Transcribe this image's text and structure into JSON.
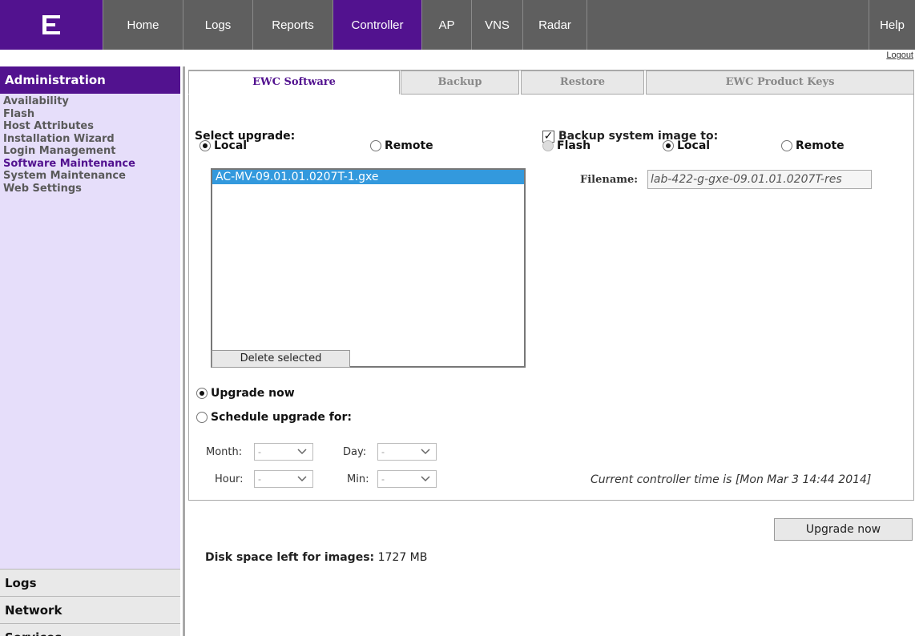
{
  "nav": {
    "items": [
      "Home",
      "Logs",
      "Reports",
      "Controller",
      "AP",
      "VNS",
      "Radar"
    ],
    "active": "Controller",
    "help": "Help",
    "logo_icon": "extreme-logo-icon"
  },
  "logout": "Logout",
  "sidebar": {
    "header": "Administration",
    "links": [
      "Availability",
      "Flash",
      "Host Attributes",
      "Installation Wizard",
      "Login Management",
      "Software Maintenance",
      "System Maintenance",
      "Web Settings"
    ],
    "current": "Software Maintenance",
    "sections": [
      "Logs",
      "Network",
      "Services"
    ]
  },
  "tabs": [
    "EWC Software",
    "Backup",
    "Restore",
    "EWC Product Keys"
  ],
  "upgrade": {
    "select_label": "Select upgrade:",
    "local": "Local",
    "remote": "Remote",
    "selected_source": "Local",
    "images": [
      "AC-MV-09.01.01.0207T-1.gxe"
    ],
    "delete_button": "Delete selected",
    "upgrade_now_label": "Upgrade now",
    "schedule_label": "Schedule upgrade for:",
    "month_label": "Month:",
    "day_label": "Day:",
    "hour_label": "Hour:",
    "min_label": "Min:",
    "month_value": "-",
    "day_value": "-",
    "hour_value": "-",
    "min_value": "-"
  },
  "backup": {
    "checkbox_label": "Backup system image to:",
    "checked": true,
    "flash": "Flash",
    "local": "Local",
    "remote": "Remote",
    "selected": "Local",
    "filename_label": "Filename:",
    "filename_value": "lab-422-g-gxe-09.01.01.0207T-res"
  },
  "controller_time": "Current controller time is [Mon Mar 3 14:44 2014]",
  "upgrade_button": "Upgrade now",
  "disk": {
    "label": "Disk space left for images:",
    "value": "1727 MB"
  },
  "colors": {
    "accent": "#52128f",
    "nav_bg": "#5f5f5f",
    "sidebar_bg": "#e6defa",
    "selection": "#3399dd"
  }
}
